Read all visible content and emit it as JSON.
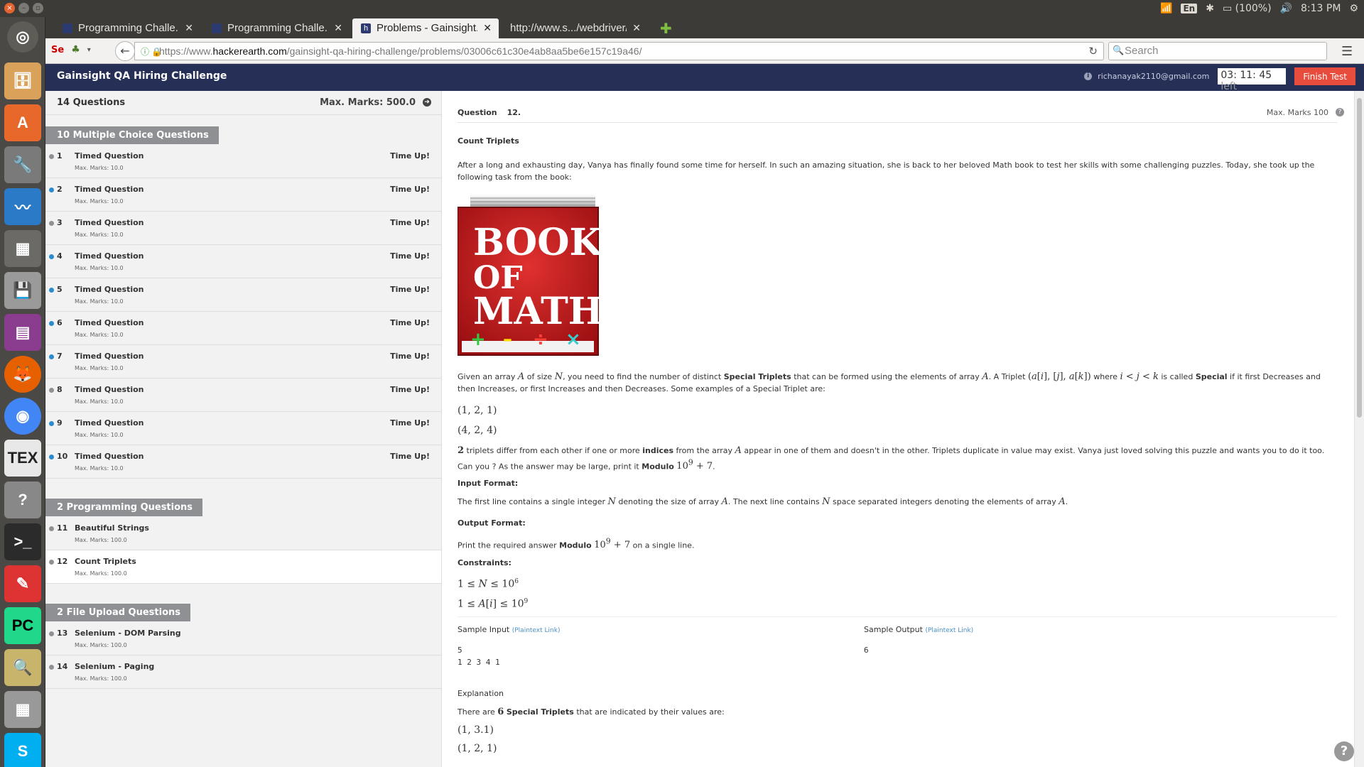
{
  "system": {
    "wifi": "wifi-icon",
    "lang": "En",
    "battery": "(100%)",
    "time": "8:13 PM"
  },
  "browser": {
    "tabs": [
      {
        "label": "Programming Challe..."
      },
      {
        "label": "Programming Challe..."
      },
      {
        "label": "Problems - Gainsight..."
      },
      {
        "label": "http://www.s.../webdriver/"
      }
    ],
    "url_prefix": "https://www.",
    "url_host": "hackerearth.com",
    "url_path": "/gainsight-qa-hiring-challenge/problems/03006c61c30e4ab8aa5be6e157c19a46/",
    "search_placeholder": "Search"
  },
  "header": {
    "title": "Gainsight QA Hiring Challenge",
    "email": "richanayak2110@gmail.com",
    "timer": "03: 11: 45",
    "timer_suffix": "left",
    "finish_label": "Finish Test"
  },
  "sidebar": {
    "count": "14 Questions",
    "max_marks": "Max. Marks: 500.0",
    "sections": [
      {
        "title": "10 Multiple Choice Questions",
        "questions": [
          {
            "num": "1",
            "title": "Timed Question",
            "marks": "Max. Marks: 10.0",
            "status": "Time Up!",
            "blue": false
          },
          {
            "num": "2",
            "title": "Timed Question",
            "marks": "Max. Marks: 10.0",
            "status": "Time Up!",
            "blue": true
          },
          {
            "num": "3",
            "title": "Timed Question",
            "marks": "Max. Marks: 10.0",
            "status": "Time Up!",
            "blue": false
          },
          {
            "num": "4",
            "title": "Timed Question",
            "marks": "Max. Marks: 10.0",
            "status": "Time Up!",
            "blue": true
          },
          {
            "num": "5",
            "title": "Timed Question",
            "marks": "Max. Marks: 10.0",
            "status": "Time Up!",
            "blue": true
          },
          {
            "num": "6",
            "title": "Timed Question",
            "marks": "Max. Marks: 10.0",
            "status": "Time Up!",
            "blue": true
          },
          {
            "num": "7",
            "title": "Timed Question",
            "marks": "Max. Marks: 10.0",
            "status": "Time Up!",
            "blue": true
          },
          {
            "num": "8",
            "title": "Timed Question",
            "marks": "Max. Marks: 10.0",
            "status": "Time Up!",
            "blue": false
          },
          {
            "num": "9",
            "title": "Timed Question",
            "marks": "Max. Marks: 10.0",
            "status": "Time Up!",
            "blue": true
          },
          {
            "num": "10",
            "title": "Timed Question",
            "marks": "Max. Marks: 10.0",
            "status": "Time Up!",
            "blue": true
          }
        ]
      },
      {
        "title": "2 Programming Questions",
        "questions": [
          {
            "num": "11",
            "title": "Beautiful Strings",
            "marks": "Max. Marks: 100.0",
            "status": "",
            "blue": false
          },
          {
            "num": "12",
            "title": "Count Triplets",
            "marks": "Max. Marks: 100.0",
            "status": "",
            "blue": false,
            "current": true
          }
        ]
      },
      {
        "title": "2 File Upload Questions",
        "questions": [
          {
            "num": "13",
            "title": "Selenium - DOM Parsing",
            "marks": "Max. Marks: 100.0",
            "status": "",
            "blue": false
          },
          {
            "num": "14",
            "title": "Selenium - Paging",
            "marks": "Max. Marks: 100.0",
            "status": "",
            "blue": false
          }
        ]
      }
    ]
  },
  "question": {
    "label": "Question",
    "number": "12.",
    "max_marks": "Max. Marks 100",
    "title": "Count Triplets",
    "intro": "After a long and exhausting day, Vanya has finally found some time for herself. In such an amazing situation, she is back to her beloved Math book to test her skills with some challenging puzzles. Today, she took up the following task from the book:",
    "book": {
      "line1": "BOOK",
      "line2": "OF",
      "line3": "MATH"
    },
    "input_format_title": "Input Format:",
    "input_format_text": "The first line contains a single integer",
    "output_format_title": "Output Format:",
    "constraints_title": "Constraints:",
    "sample_input_title": "Sample Input",
    "sample_output_title": "Sample Output",
    "plaintext_link": "(Plaintext Link)",
    "sample_input_lines": [
      "5",
      "1 2 3 4 1"
    ],
    "sample_output_lines": [
      "6"
    ],
    "explanation_title": "Explanation",
    "explanation_text": "that are indicated by their values are:",
    "example1": "(1, 2, 1)",
    "example2": "(4, 2, 4)",
    "explanation_example1": "(1, 3.1)",
    "explanation_example2": "(1, 2, 1)"
  }
}
